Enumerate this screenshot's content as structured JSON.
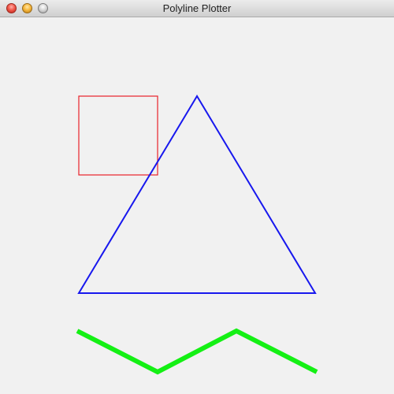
{
  "window": {
    "title": "Polyline Plotter"
  },
  "colors": {
    "canvas_background": "#f1f1f1",
    "rectangle_stroke": "#e8222a",
    "triangle_stroke": "#1818ee",
    "polyline_stroke": "#14f014"
  },
  "icons": {
    "close": "close-icon",
    "minimize": "minimize-icon",
    "zoom": "zoom-icon"
  },
  "shapes": [
    {
      "name": "red-rectangle",
      "type": "rectangle",
      "color": "#e8222a"
    },
    {
      "name": "blue-triangle",
      "type": "triangle",
      "color": "#1818ee"
    },
    {
      "name": "green-zigzag-polyline",
      "type": "polyline",
      "color": "#14f014"
    }
  ]
}
